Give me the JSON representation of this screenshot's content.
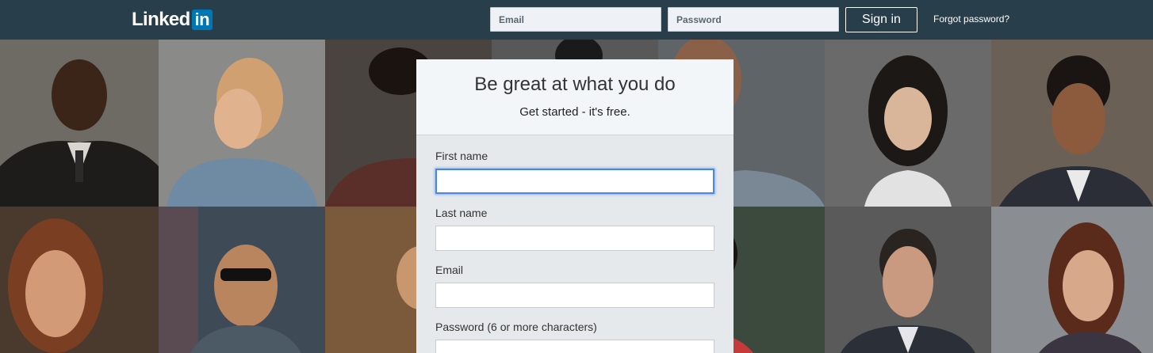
{
  "header": {
    "logo_word": "Linked",
    "logo_box": "in",
    "email_placeholder": "Email",
    "password_placeholder": "Password",
    "signin_label": "Sign in",
    "forgot_label": "Forgot password?"
  },
  "signup": {
    "title": "Be great at what you do",
    "subtitle": "Get started - it's free.",
    "fields": [
      {
        "label": "First name",
        "value": "",
        "focused": true
      },
      {
        "label": "Last name",
        "value": ""
      },
      {
        "label": "Email",
        "value": ""
      },
      {
        "label": "Password (6 or more characters)",
        "value": ""
      }
    ]
  },
  "colors": {
    "header_bg": "#283e4a",
    "brand_blue": "#0077b5",
    "focus_ring": "#4a86e8",
    "card_bg": "#e6e9ec"
  }
}
